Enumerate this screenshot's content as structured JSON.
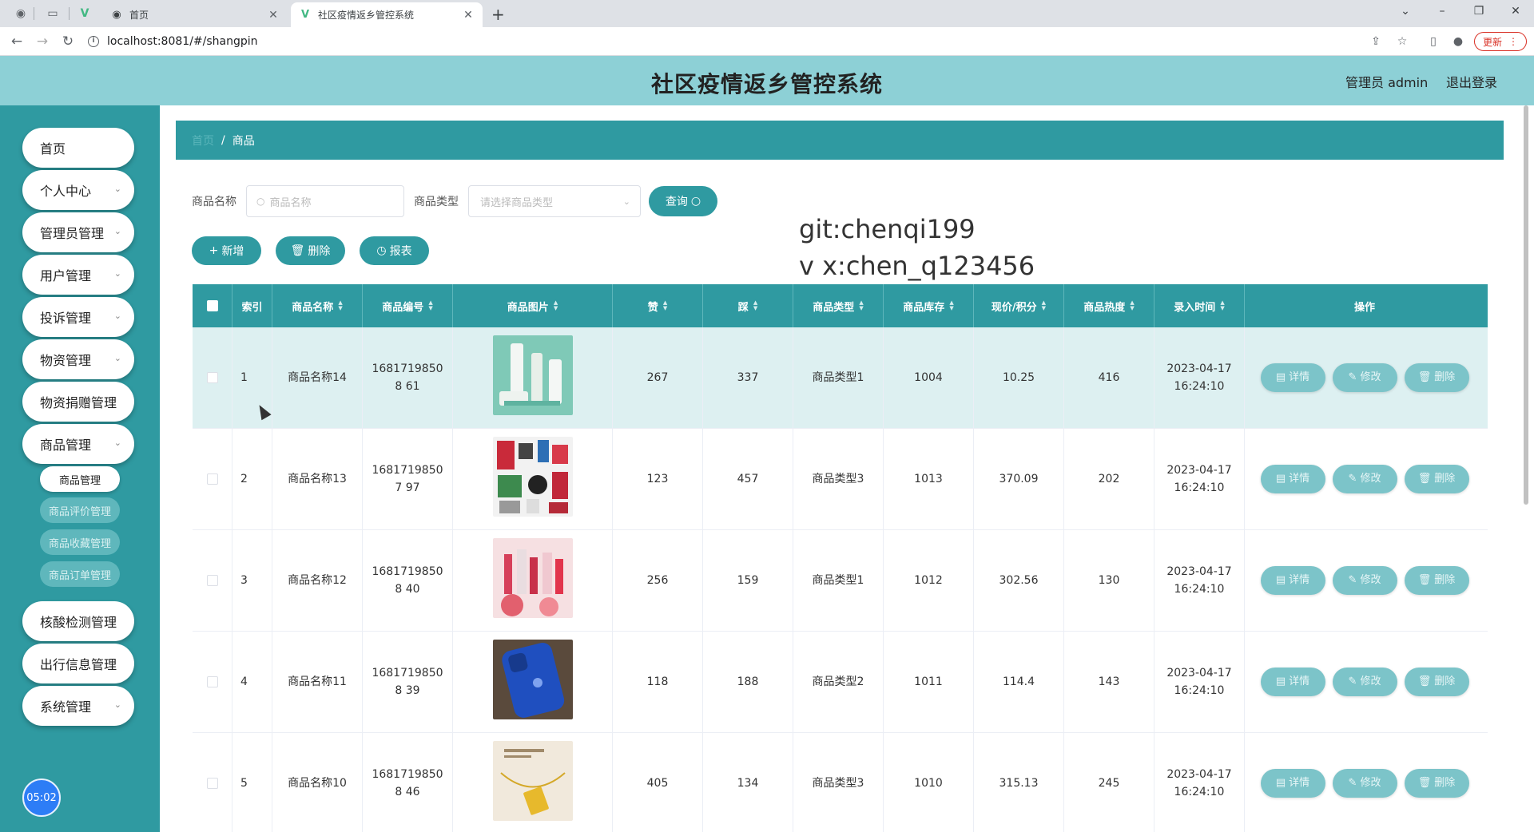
{
  "browser": {
    "tabs": [
      {
        "title": "首页",
        "active": false
      },
      {
        "title": "社区疫情返乡管控系统",
        "active": true
      }
    ],
    "url": "localhost:8081/#/shangpin",
    "update_label": "更新"
  },
  "header": {
    "title": "社区疫情返乡管控系统",
    "user": "管理员 admin",
    "logout": "退出登录"
  },
  "sidebar": {
    "items": [
      {
        "label": "首页",
        "has_chevron": false
      },
      {
        "label": "个人中心",
        "has_chevron": true
      },
      {
        "label": "管理员管理",
        "has_chevron": true
      },
      {
        "label": "用户管理",
        "has_chevron": true
      },
      {
        "label": "投诉管理",
        "has_chevron": true
      },
      {
        "label": "物资管理",
        "has_chevron": true
      },
      {
        "label": "物资捐赠管理",
        "has_chevron": false
      },
      {
        "label": "商品管理",
        "has_chevron": true
      },
      {
        "label": "核酸检测管理",
        "has_chevron": false
      },
      {
        "label": "出行信息管理",
        "has_chevron": false
      },
      {
        "label": "系统管理",
        "has_chevron": true
      }
    ],
    "sub_items": [
      "商品管理",
      "商品评价管理",
      "商品收藏管理",
      "商品订单管理"
    ],
    "timer": "05:02"
  },
  "breadcrumb": {
    "home": "首页",
    "current": "商品"
  },
  "search": {
    "name_label": "商品名称",
    "name_placeholder": "商品名称",
    "type_label": "商品类型",
    "type_placeholder": "请选择商品类型",
    "query_label": "查询"
  },
  "actions": {
    "add": "新增",
    "delete": "删除",
    "report": "报表"
  },
  "watermark": {
    "line1": "git:chenqi199",
    "line2": "v x:chen_q123456"
  },
  "table": {
    "headers": [
      "索引",
      "商品名称",
      "商品编号",
      "商品图片",
      "赞",
      "踩",
      "商品类型",
      "商品库存",
      "现价/积分",
      "商品热度",
      "录入时间",
      "操作"
    ],
    "row_buttons": {
      "detail": "详情",
      "edit": "修改",
      "delete": "删除"
    },
    "rows": [
      {
        "index": "1",
        "name": "商品名称14",
        "code": "16817198508 61",
        "image": "skincare-bottles",
        "like": "267",
        "dislike": "337",
        "type": "商品类型1",
        "stock": "1004",
        "price": "10.25",
        "heat": "416",
        "time": "2023-04-17 16:24:10",
        "highlight": true
      },
      {
        "index": "2",
        "name": "商品名称13",
        "code": "16817198507 97",
        "image": "cosmetics-collection",
        "like": "123",
        "dislike": "457",
        "type": "商品类型3",
        "stock": "1013",
        "price": "370.09",
        "heat": "202",
        "time": "2023-04-17 16:24:10",
        "highlight": false
      },
      {
        "index": "3",
        "name": "商品名称12",
        "code": "16817198508 40",
        "image": "lipsticks",
        "like": "256",
        "dislike": "159",
        "type": "商品类型1",
        "stock": "1012",
        "price": "302.56",
        "heat": "130",
        "time": "2023-04-17 16:24:10",
        "highlight": false
      },
      {
        "index": "4",
        "name": "商品名称11",
        "code": "16817198508 39",
        "image": "blue-phone",
        "like": "118",
        "dislike": "188",
        "type": "商品类型2",
        "stock": "1011",
        "price": "114.4",
        "heat": "143",
        "time": "2023-04-17 16:24:10",
        "highlight": false
      },
      {
        "index": "5",
        "name": "商品名称10",
        "code": "16817198508 46",
        "image": "gold-pendant",
        "like": "405",
        "dislike": "134",
        "type": "商品类型3",
        "stock": "1010",
        "price": "315.13",
        "heat": "245",
        "time": "2023-04-17 16:24:10",
        "highlight": false
      }
    ]
  },
  "colors": {
    "primary": "#2f9aa1",
    "header_bg": "#8dd0d6",
    "row_highlight": "#ddf0f1"
  }
}
